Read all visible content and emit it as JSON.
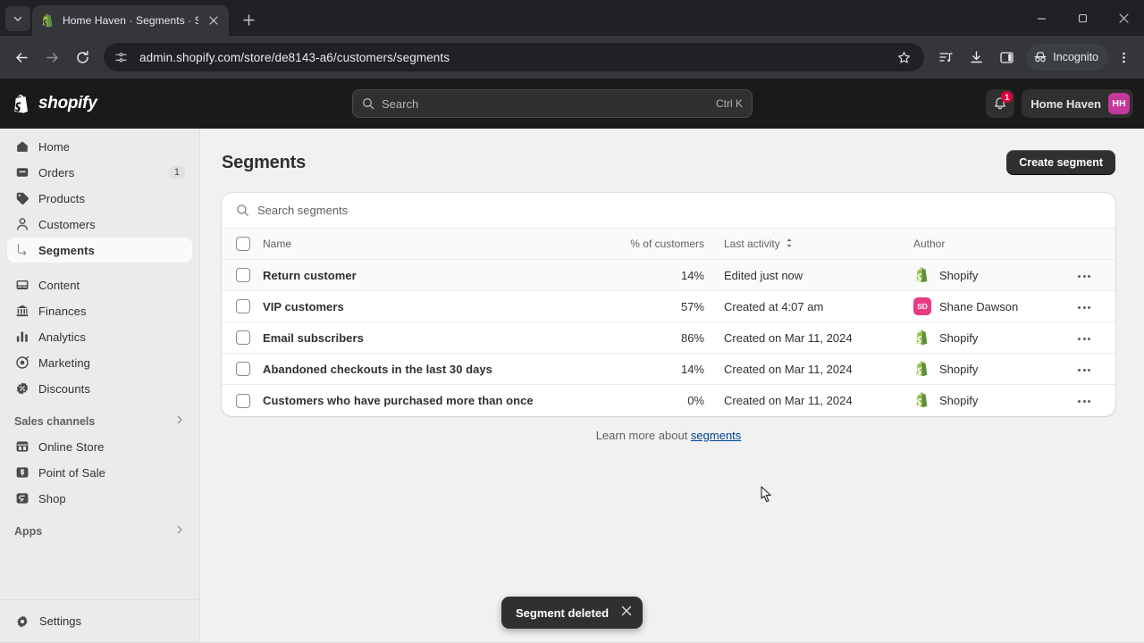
{
  "browser": {
    "tab": {
      "title": "Home Haven · Segments · Shop",
      "favicon": "shopify-bag-icon"
    },
    "new_tab_label": "+",
    "url": "admin.shopify.com/store/de8143-a6/customers/segments",
    "incognito_label": "Incognito",
    "controls": {
      "back": "back-arrow",
      "forward": "forward-arrow",
      "reload": "reload-icon",
      "minimize": "—",
      "maximize": "▢",
      "close": "✕"
    }
  },
  "topbar": {
    "brand": "shopify",
    "search": {
      "placeholder": "Search",
      "shortcut": "Ctrl K"
    },
    "notifications_count": "1",
    "store": {
      "name": "Home Haven",
      "initials": "HH",
      "avatar_color": "#c4379b"
    }
  },
  "sidebar": {
    "items": [
      {
        "label": "Home",
        "icon": "home-icon",
        "badge": ""
      },
      {
        "label": "Orders",
        "icon": "orders-icon",
        "badge": "1"
      },
      {
        "label": "Products",
        "icon": "products-tag-icon",
        "badge": ""
      },
      {
        "label": "Customers",
        "icon": "customers-person-icon",
        "badge": ""
      },
      {
        "label": "Segments",
        "icon": "sub-elbow-icon",
        "badge": "",
        "sub": true,
        "active": true
      },
      {
        "label": "Content",
        "icon": "content-icon",
        "badge": ""
      },
      {
        "label": "Finances",
        "icon": "finances-bank-icon",
        "badge": ""
      },
      {
        "label": "Analytics",
        "icon": "analytics-bars-icon",
        "badge": ""
      },
      {
        "label": "Marketing",
        "icon": "marketing-target-icon",
        "badge": ""
      },
      {
        "label": "Discounts",
        "icon": "discounts-badge-icon",
        "badge": ""
      }
    ],
    "sales_channels": {
      "label": "Sales channels",
      "items": [
        {
          "label": "Online Store",
          "icon": "online-store-icon"
        },
        {
          "label": "Point of Sale",
          "icon": "point-of-sale-icon"
        },
        {
          "label": "Shop",
          "icon": "shop-icon"
        }
      ]
    },
    "apps": {
      "label": "Apps"
    },
    "settings": {
      "label": "Settings",
      "icon": "gear-icon"
    }
  },
  "main": {
    "page_title": "Segments",
    "create_button": "Create segment",
    "search_placeholder": "Search segments",
    "columns": {
      "name": "Name",
      "percent": "% of customers",
      "last_activity": "Last activity",
      "author": "Author"
    },
    "rows": [
      {
        "name": "Return customer",
        "percent": "14%",
        "activity": "Edited just now",
        "author": "Shopify",
        "author_type": "shopify",
        "author_initials": "",
        "highlight": true
      },
      {
        "name": "VIP customers",
        "percent": "57%",
        "activity": "Created at 4:07 am",
        "author": "Shane Dawson",
        "author_type": "user",
        "author_initials": "SD",
        "avatar_color": "#ea3a86",
        "highlight": false
      },
      {
        "name": "Email subscribers",
        "percent": "86%",
        "activity": "Created on Mar 11, 2024",
        "author": "Shopify",
        "author_type": "shopify",
        "author_initials": "",
        "highlight": false
      },
      {
        "name": "Abandoned checkouts in the last 30 days",
        "percent": "14%",
        "activity": "Created on Mar 11, 2024",
        "author": "Shopify",
        "author_type": "shopify",
        "author_initials": "",
        "highlight": false
      },
      {
        "name": "Customers who have purchased more than once",
        "percent": "0%",
        "activity": "Created on Mar 11, 2024",
        "author": "Shopify",
        "author_type": "shopify",
        "author_initials": "",
        "highlight": false
      }
    ],
    "footer": {
      "text": "Learn more about ",
      "link": "segments"
    }
  },
  "toast": {
    "message": "Segment deleted",
    "close": "✕"
  },
  "colors": {
    "accent_dark": "#303030",
    "link": "#004299",
    "shopify_green": "#7ab55c",
    "badge_red": "#e0003c"
  }
}
